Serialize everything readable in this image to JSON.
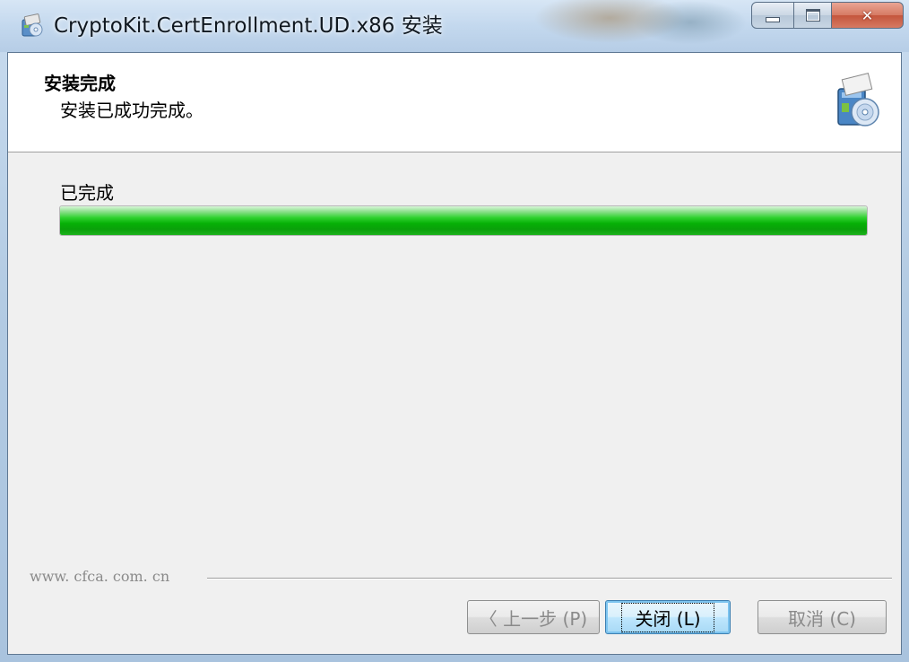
{
  "window": {
    "title": "CryptoKit.CertEnrollment.UD.x86 安装"
  },
  "header": {
    "title": "安装完成",
    "subtitle": "安装已成功完成。"
  },
  "progress": {
    "label": "已完成",
    "value_percent": 100
  },
  "footer": {
    "brand": "www. cfca. com. cn"
  },
  "buttons": {
    "back": "〈 上一步 (P)",
    "close": "关闭 (L)",
    "cancel": "取消 (C)"
  },
  "colors": {
    "progress": "#06b006",
    "close_button_border": "#3c7fb1",
    "window_frame": "#b6cde6"
  },
  "icons": [
    "installer-app-icon",
    "minimize-icon",
    "maximize-icon",
    "close-icon",
    "installer-package-icon"
  ]
}
